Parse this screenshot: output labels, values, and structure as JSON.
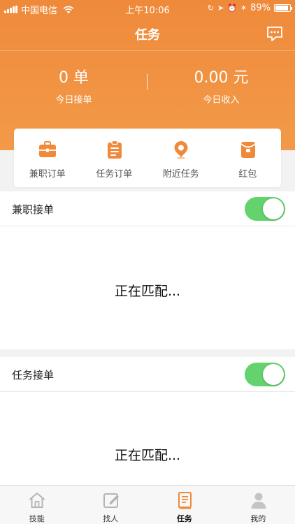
{
  "status_bar": {
    "carrier": "中国电信",
    "time": "上午10:06",
    "battery": "89%",
    "battery_level": 0.89
  },
  "nav": {
    "title": "任务",
    "chat_icon": "chat-bubble-icon"
  },
  "stats": {
    "orders_value": "0 单",
    "orders_label": "今日接单",
    "income_value": "0.00 元",
    "income_label": "今日收入"
  },
  "quick_menu": [
    {
      "label": "兼职订单",
      "icon": "briefcase-icon"
    },
    {
      "label": "任务订单",
      "icon": "clipboard-icon"
    },
    {
      "label": "附近任务",
      "icon": "location-pin-icon"
    },
    {
      "label": "红包",
      "icon": "red-envelope-icon"
    }
  ],
  "sections": [
    {
      "title": "兼职接单",
      "toggle_on": true,
      "status": "正在匹配..."
    },
    {
      "title": "任务接单",
      "toggle_on": true,
      "status": "正在匹配..."
    }
  ],
  "tabbar": [
    {
      "label": "技能",
      "icon": "home-icon",
      "active": false
    },
    {
      "label": "找人",
      "icon": "edit-icon",
      "active": false
    },
    {
      "label": "任务",
      "icon": "book-icon",
      "active": true
    },
    {
      "label": "我的",
      "icon": "person-icon",
      "active": false
    }
  ],
  "colors": {
    "accent": "#EF8A3B",
    "toggle_on": "#64D36D",
    "tab_inactive_icon": "#B5B5B5"
  }
}
